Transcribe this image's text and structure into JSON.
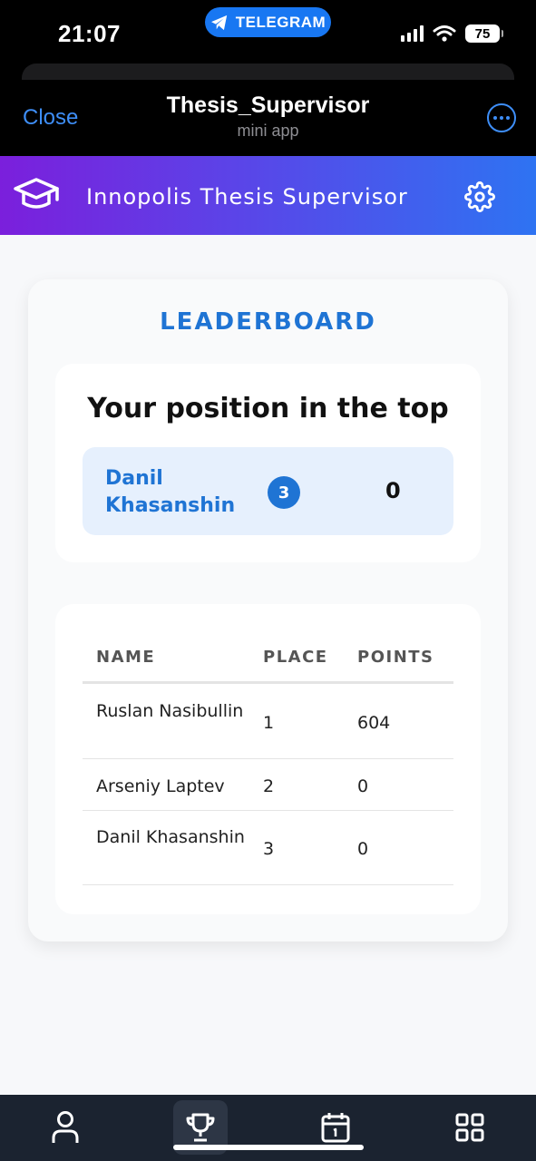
{
  "status_bar": {
    "time": "21:07",
    "pill_label": "TELEGRAM",
    "battery": "75"
  },
  "telegram_header": {
    "close_label": "Close",
    "title": "Thesis_Supervisor",
    "subtitle": "mini app",
    "more_icon": "ellipsis-circle-icon"
  },
  "app_banner": {
    "title": "Innopolis Thesis Supervisor",
    "logo_icon": "graduation-cap-icon",
    "settings_icon": "gear-icon",
    "gradient": [
      "#7b1fdc",
      "#2e73f2"
    ]
  },
  "leaderboard": {
    "title": "LEADERBOARD",
    "your_position": {
      "heading": "Your position in the top",
      "name": "Danil Khasanshin",
      "place": "3",
      "points": "0"
    },
    "table": {
      "headers": [
        "NAME",
        "PLACE",
        "POINTS"
      ],
      "rows": [
        {
          "name": "Ruslan Nasibullin",
          "place": "1",
          "points": "604"
        },
        {
          "name": "Arseniy Laptev",
          "place": "2",
          "points": "0"
        },
        {
          "name": "Danil Khasanshin",
          "place": "3",
          "points": "0"
        }
      ]
    }
  },
  "bottom_nav": {
    "items": [
      {
        "icon": "user-icon",
        "active": false
      },
      {
        "icon": "trophy-icon",
        "active": true
      },
      {
        "icon": "calendar-icon",
        "active": false
      },
      {
        "icon": "grid-icon",
        "active": false
      }
    ]
  },
  "colors": {
    "accent": "#1f74d4",
    "nav_background": "#1b2330",
    "telegram_blue": "#3e8ef7"
  }
}
